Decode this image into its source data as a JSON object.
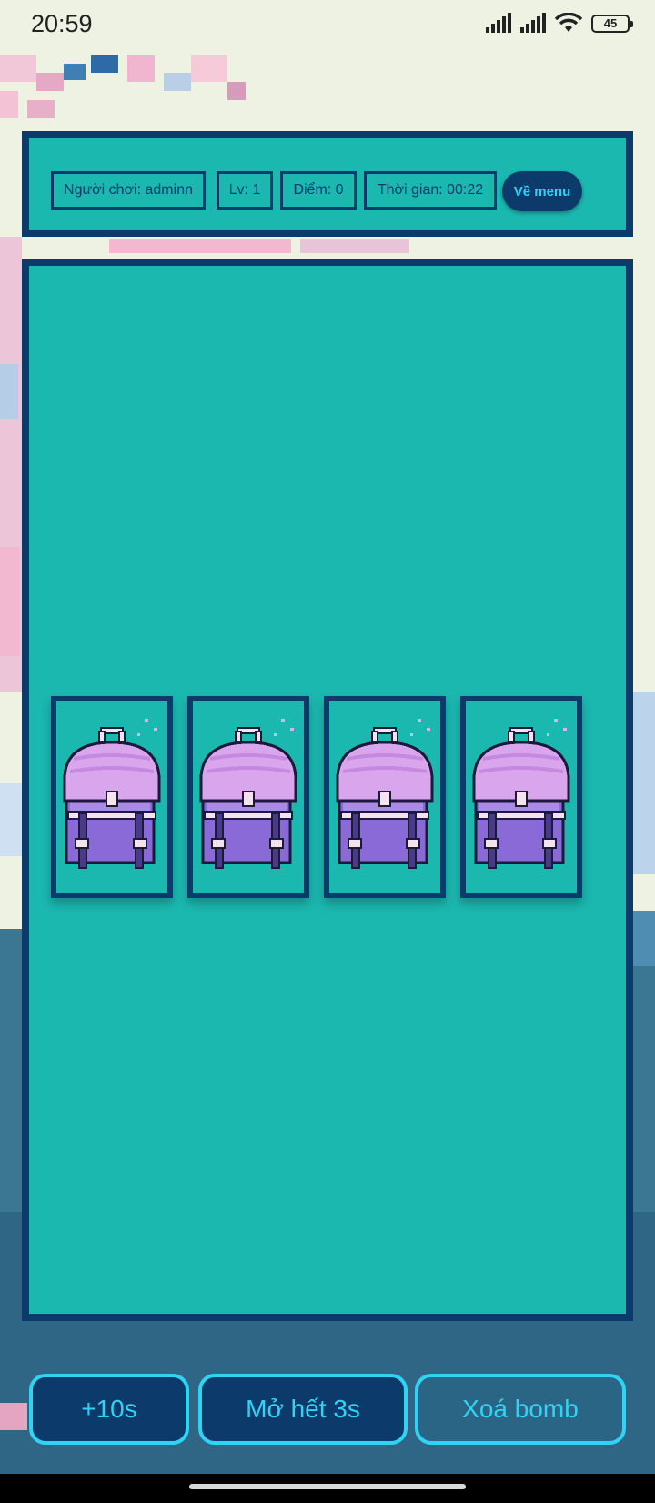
{
  "status_bar": {
    "time": "20:59",
    "battery": "45"
  },
  "header": {
    "player": "Người chơi: adminn",
    "level": "Lv: 1",
    "score": "Điểm: 0",
    "timer": "Thời gian: 00:22",
    "menu_button": "Về menu"
  },
  "board": {
    "cards": [
      {
        "face": "backpack-icon"
      },
      {
        "face": "backpack-icon"
      },
      {
        "face": "backpack-icon"
      },
      {
        "face": "backpack-icon"
      }
    ]
  },
  "powerups": {
    "add_time": "+10s",
    "reveal_all": "Mở hết 3s",
    "remove_bomb": "Xoá bomb"
  },
  "colors": {
    "board_bg": "#1bb8b0",
    "frame": "#0b3a6b",
    "accent": "#2fd4f4",
    "backpack_light": "#d9a6ee",
    "backpack_dark": "#8a6ad6"
  }
}
